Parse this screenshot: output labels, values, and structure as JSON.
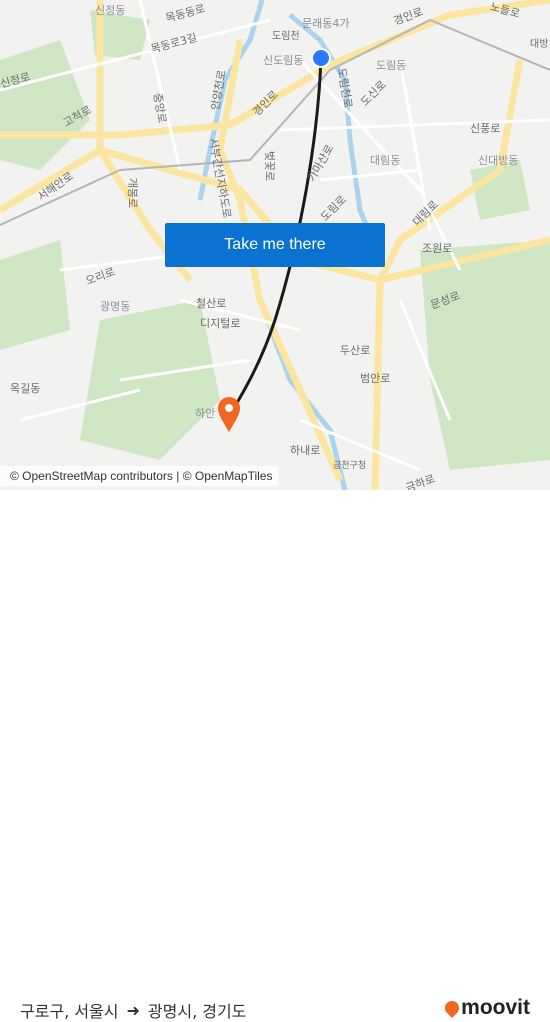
{
  "map": {
    "labels": {
      "sinjeongdong": "신정동",
      "mokdongdongro": "목동동로",
      "mundae": "문래동4가",
      "gyeonginro_top": "경인로",
      "norro": "노들로",
      "dorimcheon": "도림천",
      "mokdongro3": "목동로3길",
      "sindorim": "신도림동",
      "dorimdong": "도림동",
      "daebang": "대방",
      "sinjeongro": "신정로",
      "anyangcheonro": "안양천로",
      "jungangro": "중앙로",
      "gyeonginro": "경인로",
      "dorimcheonro": "도림천로",
      "dosinro": "도신로",
      "gocheokro": "고척로",
      "sinpungro": "신풍로",
      "seobu": "서부간선지하도로",
      "daerimdong": "대림동",
      "sindaebang": "신대방동",
      "seohaeanro": "서해안로",
      "gaebongro": "개봉로",
      "beotkkotro": "벚꽃로",
      "gamasanro": "가마산로",
      "dorimro": "도림로",
      "daerimro": "대림로",
      "sindaebang2": "신대방",
      "oriro": "오리로",
      "joweonro": "조원로",
      "gwangmyeongdong": "광명동",
      "cheolsanro": "철산로",
      "digitalro": "디지털로",
      "munseongro": "문성로",
      "dusanro": "두산로",
      "beomanro": "범안로",
      "haan": "하안",
      "ogildong": "옥길동",
      "geumharo": "금하로",
      "hanaero": "하내로",
      "geumcheongu": "금천구청"
    },
    "route_color": "#1a1a1a",
    "origin_color": "#2979ff",
    "destination_color": "#f26522",
    "origin_icon": "origin-dot-icon",
    "destination_icon": "map-pin-icon"
  },
  "cta": {
    "label": "Take me there",
    "color": "#0a73d1"
  },
  "attribution": "© OpenStreetMap contributors | © OpenMapTiles",
  "footer": {
    "origin": "구로구, 서울시",
    "arrow_icon": "arrow-right-icon",
    "destination": "광명시, 경기도",
    "brand": "moovit",
    "brand_color": "#f26522"
  }
}
